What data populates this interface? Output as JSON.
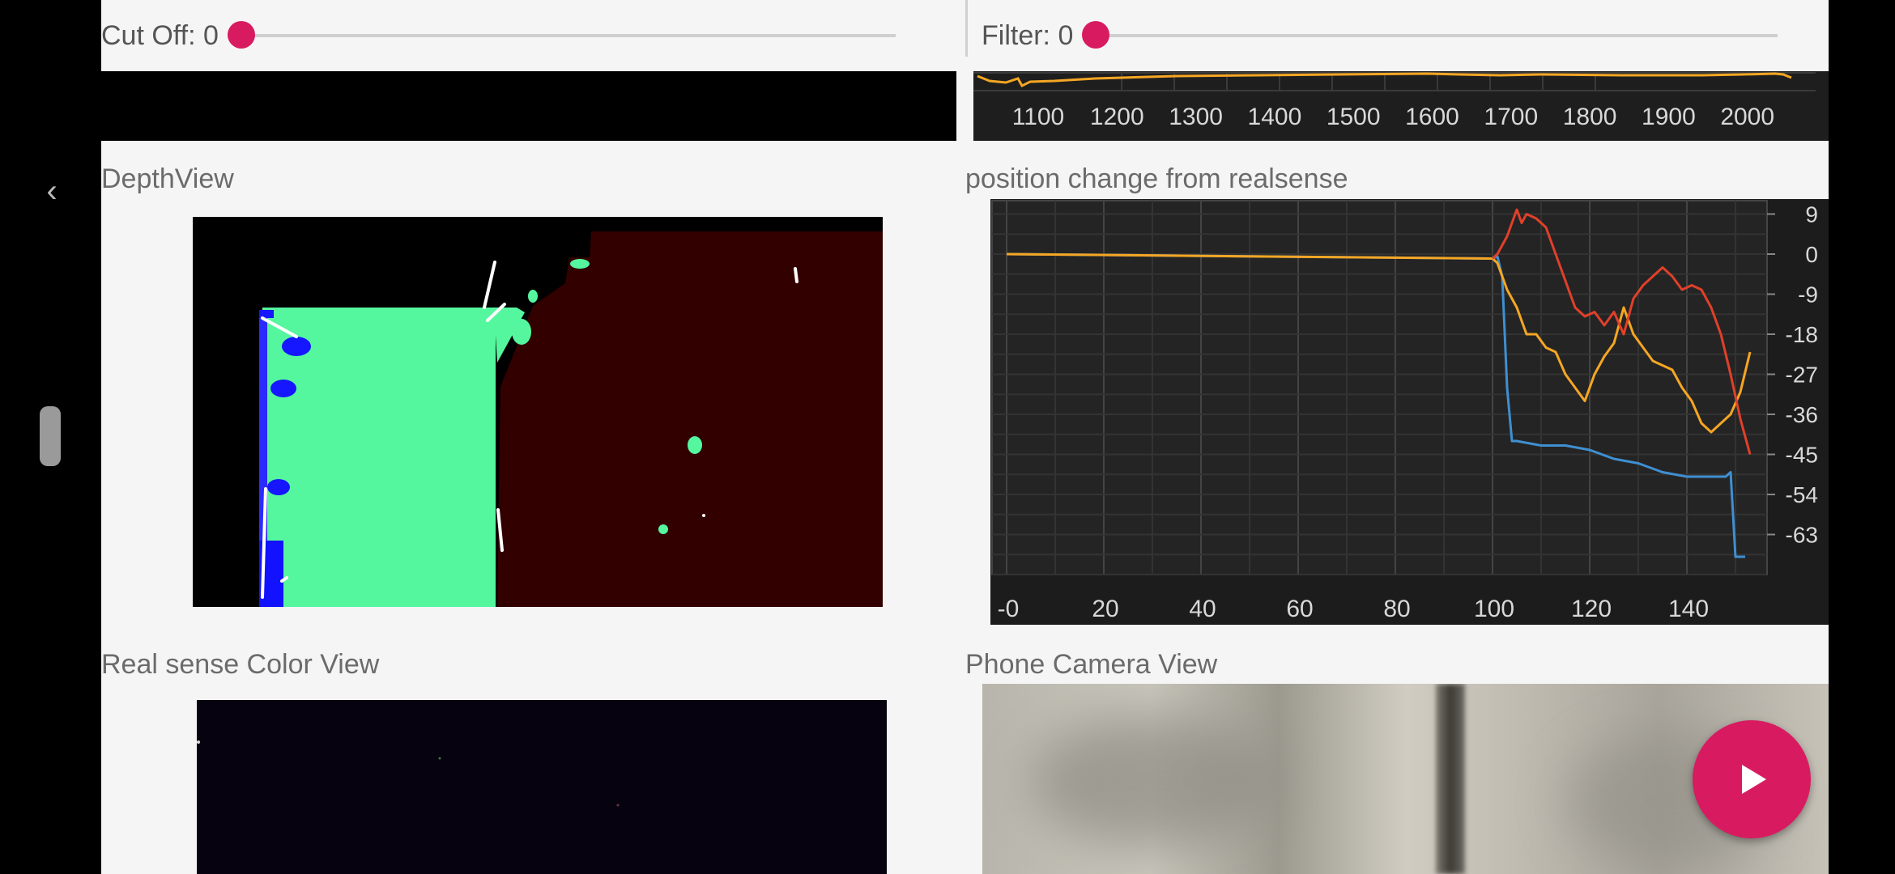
{
  "sliders": {
    "cutoff": {
      "label": "Cut Off: 0",
      "value": 0
    },
    "filter": {
      "label": "Filter: 0",
      "value": 0
    }
  },
  "top_chart": {
    "x_ticks": [
      "1100",
      "1200",
      "1300",
      "1400",
      "1500",
      "1600",
      "1700",
      "1800",
      "1900",
      "2000"
    ],
    "colors": {
      "series": "#f5a623"
    }
  },
  "sections": {
    "depth_view": "DepthView",
    "position_chart": "position change from realsense",
    "realsense_color": "Real sense Color View",
    "phone_camera": "Phone Camera View"
  },
  "chart_data": {
    "type": "line",
    "title": "position change from realsense",
    "xlim": [
      -2,
      155
    ],
    "ylim": [
      -72,
      12
    ],
    "x_ticks": [
      "-0",
      "20",
      "40",
      "60",
      "80",
      "100",
      "120",
      "140"
    ],
    "y_ticks": [
      "9",
      "0",
      "-9",
      "-18",
      "-27",
      "-36",
      "-45",
      "-54",
      "-63"
    ],
    "grid": true,
    "series": [
      {
        "color": "#3f8fd1",
        "x": [
          0,
          100,
          101,
          102,
          103,
          104,
          105,
          110,
          115,
          120,
          125,
          130,
          135,
          140,
          145,
          148,
          149,
          150,
          152
        ],
        "y": [
          0,
          -1,
          -0.5,
          -5,
          -30,
          -42,
          -42,
          -43,
          -43,
          -44,
          -46,
          -47,
          -49,
          -50,
          -50,
          -50,
          -49,
          -68,
          -68
        ]
      },
      {
        "color": "#f5a623",
        "x": [
          0,
          100,
          101,
          103,
          105,
          107,
          109,
          111,
          113,
          115,
          117,
          119,
          121,
          123,
          125,
          127,
          129,
          131,
          133,
          135,
          137,
          139,
          141,
          143,
          145,
          147,
          149,
          151,
          153
        ],
        "y": [
          0,
          -1,
          -2,
          -8,
          -12,
          -18,
          -18,
          -21,
          -22,
          -27,
          -30,
          -33,
          -27,
          -23,
          -20,
          -12,
          -18,
          -21,
          -24,
          -25,
          -26,
          -30,
          -33,
          -38,
          -40,
          -38,
          -36,
          -31,
          -22
        ]
      },
      {
        "color": "#e0402a",
        "x": [
          100,
          101,
          103,
          105,
          106,
          107,
          109,
          111,
          113,
          115,
          117,
          119,
          121,
          123,
          125,
          127,
          129,
          131,
          133,
          135,
          137,
          139,
          141,
          143,
          145,
          147,
          149,
          151,
          153
        ],
        "y": [
          -1,
          0,
          4,
          10,
          7,
          9,
          8,
          6,
          0,
          -6,
          -12,
          -14,
          -13,
          -16,
          -13,
          -18,
          -10,
          -7,
          -5,
          -3,
          -5,
          -8,
          -7,
          -8,
          -12,
          -18,
          -27,
          -37,
          -45
        ]
      }
    ]
  },
  "fab": {
    "icon": "play-icon",
    "color": "#d81b60"
  },
  "nav": {
    "back_icon": "chevron-left-icon"
  }
}
